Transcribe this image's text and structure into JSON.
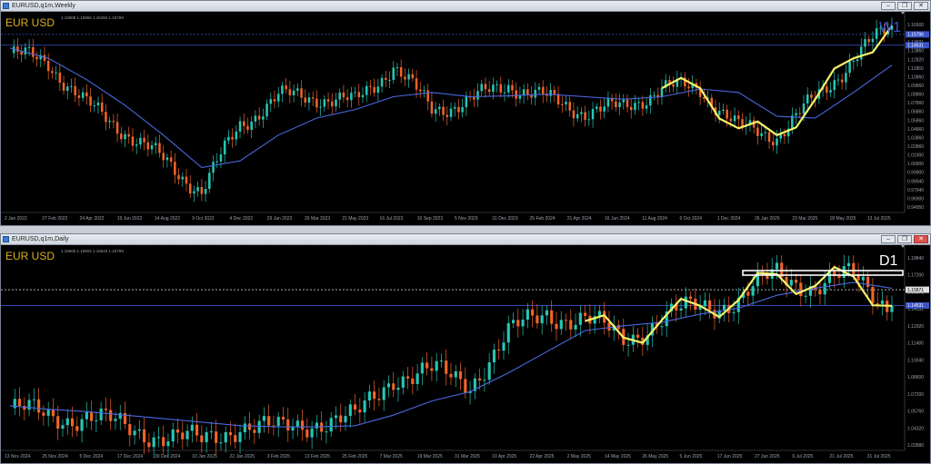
{
  "windows": [
    {
      "title": "EURUSD,q1m,Weekly",
      "symbol": "EUR USD",
      "timeframe": "W1",
      "timeframe_color": "#3a54c8",
      "ohlc": "1.15908 1.15956 1.15494 1.15799",
      "price_labels": [
        "1.16900",
        "1.15796",
        "1.14531",
        "1.13860",
        "1.12820",
        "1.11860",
        "1.10860",
        "1.09860",
        "1.08860",
        "1.07860",
        "1.06860",
        "1.05860",
        "1.04860",
        "1.03860",
        "1.02860",
        "1.01900",
        "1.00900",
        "0.99900",
        "0.98940",
        "0.97940",
        "0.96900",
        "0.94950"
      ],
      "date_labels": [
        "2 Jan 2022",
        "27 Feb 2022",
        "24 Apr 2022",
        "19 Jun 2022",
        "14 Aug 2022",
        "9 Oct 2022",
        "4 Dec 2022",
        "29 Jan 2023",
        "26 Mar 2023",
        "21 May 2023",
        "16 Jul 2023",
        "10 Sep 2023",
        "5 Nov 2023",
        "31 Dec 2023",
        "25 Feb 2024",
        "21 Apr 2024",
        "16 Jun 2024",
        "11 Aug 2024",
        "6 Oct 2024",
        "1 Dec 2024",
        "26 Jan 2025",
        "23 Mar 2025",
        "18 May 2025",
        "13 Jul 2025"
      ],
      "hlines": [
        {
          "price": "1.15796",
          "color": "#3a54c8",
          "dashed": true
        },
        {
          "price": "1.14531",
          "color": "#3a54c8",
          "dashed": false
        }
      ]
    },
    {
      "title": "EURUSD,q1m,Daily",
      "symbol": "EUR USD",
      "timeframe": "D1",
      "timeframe_color": "#ffffff",
      "ohlc": "1.15665 1.15804 1.15643 1.15799",
      "price_labels": [
        "1.18840",
        "1.17200",
        "1.15871",
        "1.14531",
        "1.12920",
        "1.11480",
        "1.10040",
        "1.08600",
        "1.07200",
        "1.05760",
        "1.04320",
        "1.02880"
      ],
      "date_labels": [
        "13 Nov 2024",
        "25 Nov 2024",
        "5 Dec 2024",
        "17 Dec 2024",
        "30 Dec 2024",
        "10 Jan 2025",
        "22 Jan 2025",
        "3 Feb 2025",
        "13 Feb 2025",
        "25 Feb 2025",
        "7 Mar 2025",
        "19 Mar 2025",
        "31 Mar 2025",
        "10 Apr 2025",
        "22 Apr 2025",
        "2 May 2025",
        "14 May 2025",
        "26 May 2025",
        "5 Jun 2025",
        "17 Jun 2025",
        "27 Jun 2025",
        "9 Jul 2025",
        "21 Jul 2025",
        "31 Jul 2025"
      ],
      "hlines": [
        {
          "price": "1.15871",
          "color": "#c8c8c8",
          "dashed": true
        },
        {
          "price": "1.14531",
          "color": "#3a54c8",
          "dashed": false
        }
      ]
    }
  ],
  "chart_data": [
    {
      "type": "line",
      "title": "EUR USD W1",
      "x": [
        "2 Jan 2022",
        "27 Feb 2022",
        "24 Apr 2022",
        "19 Jun 2022",
        "14 Aug 2022",
        "9 Oct 2022",
        "4 Dec 2022",
        "29 Jan 2023",
        "26 Mar 2023",
        "21 May 2023",
        "16 Jul 2023",
        "10 Sep 2023",
        "5 Nov 2023",
        "31 Dec 2023",
        "25 Feb 2024",
        "21 Apr 2024",
        "16 Jun 2024",
        "11 Aug 2024",
        "6 Oct 2024",
        "1 Dec 2024",
        "26 Jan 2025",
        "23 Mar 2025",
        "18 May 2025",
        "13 Jul 2025"
      ],
      "series": [
        {
          "values": [
            1.136,
            1.125,
            1.075,
            1.045,
            1.01,
            0.975,
            1.052,
            1.085,
            1.085,
            1.078,
            1.122,
            1.07,
            1.08,
            1.1,
            1.082,
            1.068,
            1.072,
            1.095,
            1.095,
            1.048,
            1.04,
            1.082,
            1.13,
            1.168
          ]
        },
        {
          "values": [
            1.142,
            1.13,
            1.105,
            1.075,
            1.04,
            1.002,
            1.01,
            1.04,
            1.06,
            1.07,
            1.085,
            1.09,
            1.085,
            1.086,
            1.088,
            1.085,
            1.082,
            1.085,
            1.094,
            1.09,
            1.062,
            1.06,
            1.09,
            1.122
          ]
        }
      ],
      "ylim": [
        0.9495,
        1.178
      ]
    },
    {
      "type": "line",
      "title": "EUR USD D1",
      "x": [
        "13 Nov 2024",
        "25 Nov 2024",
        "5 Dec 2024",
        "17 Dec 2024",
        "30 Dec 2024",
        "10 Jan 2025",
        "22 Jan 2025",
        "3 Feb 2025",
        "13 Feb 2025",
        "25 Feb 2025",
        "7 Mar 2025",
        "19 Mar 2025",
        "31 Mar 2025",
        "10 Apr 2025",
        "22 Apr 2025",
        "2 May 2025",
        "14 May 2025",
        "26 May 2025",
        "5 Jun 2025",
        "17 Jun 2025",
        "27 Jun 2025",
        "9 Jul 2025",
        "21 Jul 2025",
        "31 Jul 2025"
      ],
      "series": [
        {
          "values": [
            1.058,
            1.05,
            1.052,
            1.04,
            1.036,
            1.028,
            1.045,
            1.038,
            1.048,
            1.048,
            1.086,
            1.088,
            1.08,
            1.12,
            1.14,
            1.132,
            1.118,
            1.133,
            1.145,
            1.15,
            1.172,
            1.162,
            1.17,
            1.145
          ]
        },
        {
          "values": [
            1.06,
            1.057,
            1.055,
            1.052,
            1.049,
            1.046,
            1.043,
            1.042,
            1.042,
            1.043,
            1.052,
            1.064,
            1.072,
            1.088,
            1.106,
            1.124,
            1.128,
            1.131,
            1.138,
            1.143,
            1.154,
            1.16,
            1.165,
            1.16
          ]
        }
      ],
      "ylim": [
        1.022,
        1.192
      ]
    }
  ]
}
